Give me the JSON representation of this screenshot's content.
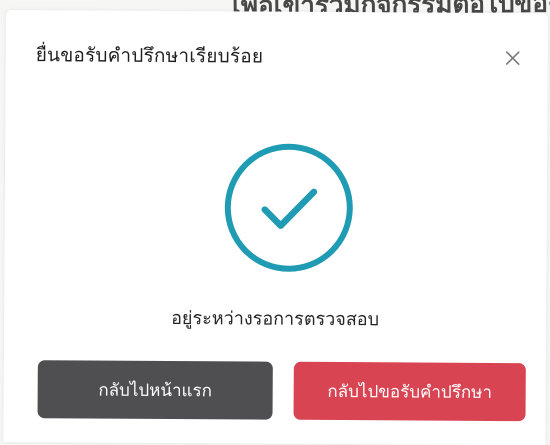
{
  "backdrop": {
    "text": "เพื่อเข้าร่วมกิจกรรมต่อไปของเรา"
  },
  "dialog": {
    "title": "ยื่นขอรับคำปรึกษาเรียบร้อย",
    "status_text": "อยู่ระหว่างรอการตรวจสอบ",
    "buttons": {
      "home_label": "กลับไปหน้าแรก",
      "request_label": "กลับไปขอรับคำปรึกษา"
    }
  },
  "colors": {
    "accent_teal": "#1f9bb3",
    "home_button": "#4f4f51",
    "request_button": "#d94453"
  },
  "icons": {
    "close": "close-icon",
    "success": "check-circle-icon"
  }
}
